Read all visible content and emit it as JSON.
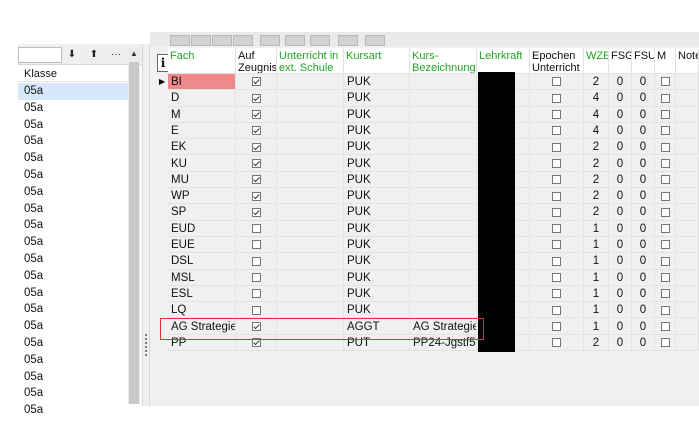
{
  "left": {
    "filter_value": "",
    "btn_down": "⬇",
    "btn_up": "⬆",
    "btn_more": "···",
    "scroll_up": "▲",
    "header": "Klasse",
    "rows": [
      "05a",
      "05a",
      "05a",
      "05a",
      "05a",
      "05a",
      "05a",
      "05a",
      "05a",
      "05a",
      "05a",
      "05a",
      "05a",
      "05a",
      "05a",
      "05a",
      "05a",
      "05a",
      "05a",
      "05a"
    ]
  },
  "grid": {
    "info_label": "i",
    "headers": {
      "fach": "Fach",
      "auf_zeugnis": "Auf\nZeugnis",
      "unterricht_ext": "Unterricht in\next. Schule",
      "kursart": "Kursart",
      "kurs_bezeichnung": "Kurs-\nBezeichnung",
      "lehrkraft": "Lehrkraft",
      "epochen": "Epochen\nUnterricht",
      "wze": "WZE",
      "fsg": "FSG",
      "fsu": "FSU",
      "m": "M",
      "notes": "Note"
    },
    "rows": [
      {
        "fach": "BI",
        "zeugnis": true,
        "kursart": "PUK",
        "bez": "",
        "wze": "2",
        "fsg": "0",
        "fsu": "0"
      },
      {
        "fach": "D",
        "zeugnis": true,
        "kursart": "PUK",
        "bez": "",
        "wze": "4",
        "fsg": "0",
        "fsu": "0"
      },
      {
        "fach": "M",
        "zeugnis": true,
        "kursart": "PUK",
        "bez": "",
        "wze": "4",
        "fsg": "0",
        "fsu": "0"
      },
      {
        "fach": "E",
        "zeugnis": true,
        "kursart": "PUK",
        "bez": "",
        "wze": "4",
        "fsg": "0",
        "fsu": "0"
      },
      {
        "fach": "EK",
        "zeugnis": true,
        "kursart": "PUK",
        "bez": "",
        "wze": "2",
        "fsg": "0",
        "fsu": "0"
      },
      {
        "fach": "KU",
        "zeugnis": true,
        "kursart": "PUK",
        "bez": "",
        "wze": "2",
        "fsg": "0",
        "fsu": "0"
      },
      {
        "fach": "MU",
        "zeugnis": true,
        "kursart": "PUK",
        "bez": "",
        "wze": "2",
        "fsg": "0",
        "fsu": "0"
      },
      {
        "fach": "WP",
        "zeugnis": true,
        "kursart": "PUK",
        "bez": "",
        "wze": "2",
        "fsg": "0",
        "fsu": "0"
      },
      {
        "fach": "SP",
        "zeugnis": true,
        "kursart": "PUK",
        "bez": "",
        "wze": "2",
        "fsg": "0",
        "fsu": "0"
      },
      {
        "fach": "EUD",
        "zeugnis": false,
        "kursart": "PUK",
        "bez": "",
        "wze": "1",
        "fsg": "0",
        "fsu": "0"
      },
      {
        "fach": "EUE",
        "zeugnis": false,
        "kursart": "PUK",
        "bez": "",
        "wze": "1",
        "fsg": "0",
        "fsu": "0"
      },
      {
        "fach": "DSL",
        "zeugnis": false,
        "kursart": "PUK",
        "bez": "",
        "wze": "1",
        "fsg": "0",
        "fsu": "0"
      },
      {
        "fach": "MSL",
        "zeugnis": false,
        "kursart": "PUK",
        "bez": "",
        "wze": "1",
        "fsg": "0",
        "fsu": "0"
      },
      {
        "fach": "ESL",
        "zeugnis": false,
        "kursart": "PUK",
        "bez": "",
        "wze": "1",
        "fsg": "0",
        "fsu": "0"
      },
      {
        "fach": "LQ",
        "zeugnis": false,
        "kursart": "PUK",
        "bez": "",
        "wze": "1",
        "fsg": "0",
        "fsu": "0"
      },
      {
        "fach": "AG Strategie",
        "zeugnis": true,
        "kursart": "AGGT",
        "bez": "AG Strategie",
        "wze": "1",
        "fsg": "0",
        "fsu": "0"
      },
      {
        "fach": "PP",
        "zeugnis": true,
        "kursart": "PUT",
        "bez": "PP24-Jgstf5",
        "wze": "2",
        "fsg": "0",
        "fsu": "0"
      }
    ],
    "selected_row_marker": "▶"
  },
  "colors": {
    "selected_fach_bg": "#f08a8a",
    "header_green": "#24a324",
    "highlight_border": "#d9362f",
    "klasse_selected_bg": "#d6e8fa"
  }
}
